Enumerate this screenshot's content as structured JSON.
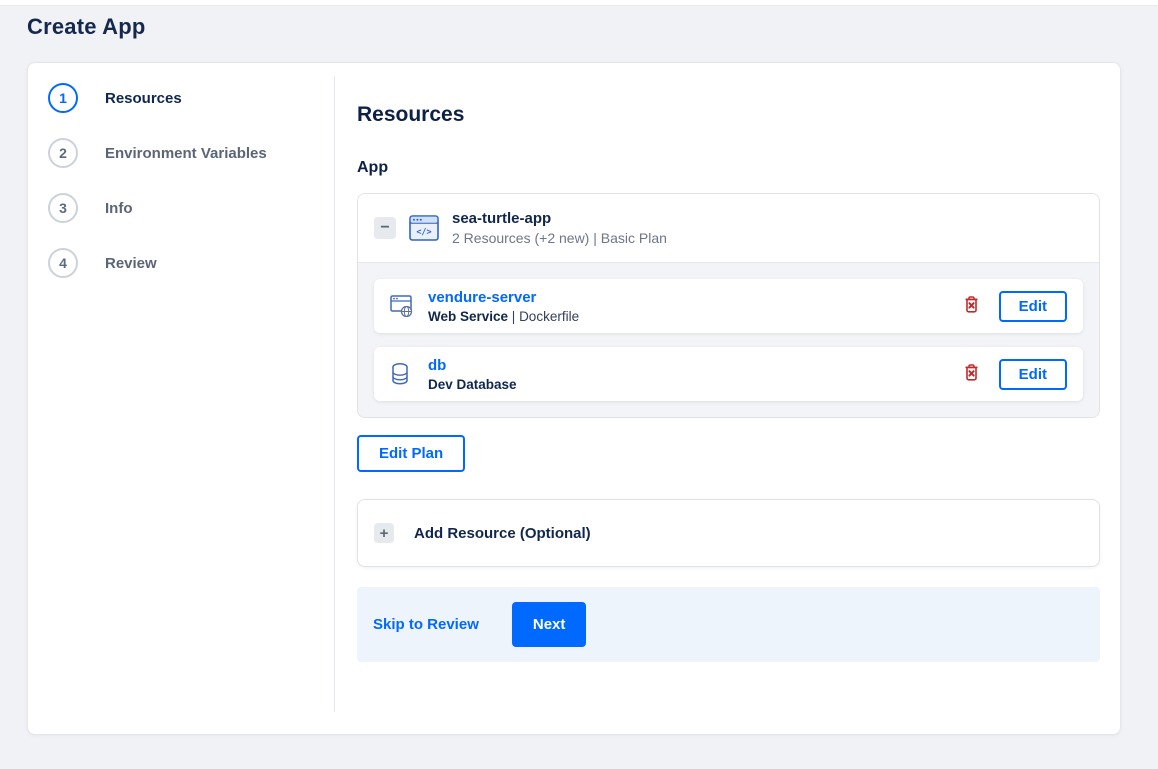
{
  "page": {
    "title": "Create App"
  },
  "stepper": {
    "steps": [
      {
        "number": "1",
        "label": "Resources",
        "active": true
      },
      {
        "number": "2",
        "label": "Environment Variables",
        "active": false
      },
      {
        "number": "3",
        "label": "Info",
        "active": false
      },
      {
        "number": "4",
        "label": "Review",
        "active": false
      }
    ]
  },
  "main": {
    "heading": "Resources",
    "section_label": "App",
    "app_group": {
      "collapse_glyph": "−",
      "icon": "app-window-code-icon",
      "name": "sea-turtle-app",
      "summary": "2 Resources (+2 new) | Basic Plan",
      "resources": [
        {
          "icon": "web-service-icon",
          "name": "vendure-server",
          "type": "Web Service",
          "separator": " | ",
          "detail": "Dockerfile",
          "delete_icon": "trash-icon",
          "edit_label": "Edit"
        },
        {
          "icon": "database-icon",
          "name": "db",
          "type": "Dev Database",
          "separator": "",
          "detail": "",
          "delete_icon": "trash-icon",
          "edit_label": "Edit"
        }
      ]
    },
    "edit_plan_label": "Edit Plan",
    "add_resource": {
      "plus_glyph": "+",
      "label": "Add Resource (Optional)"
    },
    "footer": {
      "skip_label": "Skip to Review",
      "next_label": "Next"
    }
  },
  "colors": {
    "accent_blue": "#0069ff",
    "heading_navy": "#0d2146",
    "muted_gray": "#6e7687",
    "danger_red": "#c42a2a",
    "page_background": "#f0f2f6",
    "inner_panel_gray": "#f2f4f7",
    "footer_background": "#eef4fb"
  }
}
